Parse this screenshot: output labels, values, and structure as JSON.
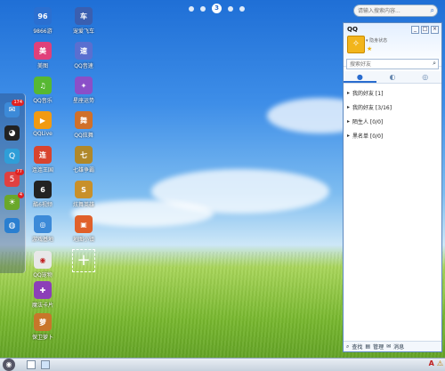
{
  "pager": {
    "current": "3"
  },
  "search": {
    "placeholder": "请输入搜索内容..."
  },
  "desktop_apps": [
    {
      "label": "9866游",
      "icon": "9866-game-icon",
      "color": "#2b6fd0",
      "glyph": "96"
    },
    {
      "label": "宠爱飞车",
      "icon": "racing-car-icon",
      "color": "#3a5fb0",
      "glyph": "车"
    },
    {
      "label": "美图",
      "icon": "meitu-icon",
      "color": "#e0407a",
      "glyph": "美"
    },
    {
      "label": "QQ音速",
      "icon": "qq-speed-icon",
      "color": "#5a6fd0",
      "glyph": "速"
    },
    {
      "label": "QQ音乐",
      "icon": "qq-music-icon",
      "color": "#57b832",
      "glyph": "♫"
    },
    {
      "label": "星座运势",
      "icon": "horoscope-icon",
      "color": "#8a4fc8",
      "glyph": "✦"
    },
    {
      "label": "QQLive",
      "icon": "qqlive-icon",
      "color": "#f29a12",
      "glyph": "▶"
    },
    {
      "label": "QQ炫舞",
      "icon": "qq-dance-icon",
      "color": "#d0702a",
      "glyph": "舞"
    },
    {
      "label": "连连王国",
      "icon": "lianlian-icon",
      "color": "#d8442f",
      "glyph": "连"
    },
    {
      "label": "七雄争霸",
      "icon": "qixiong-icon",
      "color": "#b0882a",
      "glyph": "七"
    },
    {
      "label": "酷6视频",
      "icon": "ku6-video-icon",
      "color": "#222222",
      "glyph": "6"
    },
    {
      "label": "炫舞英雄",
      "icon": "hero-icon",
      "color": "#c8902a",
      "glyph": "S"
    },
    {
      "label": "游戏基地",
      "icon": "game-base-icon",
      "color": "#3c8ad8",
      "glyph": "◎"
    },
    {
      "label": "地图小镇",
      "icon": "map-town-icon",
      "color": "#e0602a",
      "glyph": "▣"
    },
    {
      "label": "QQ宠物",
      "icon": "qq-pet-icon",
      "color": "#e8e8e8",
      "glyph": "◉"
    },
    {
      "label": "魔法卡片",
      "icon": "magic-card-icon",
      "color": "#8c3fb8",
      "glyph": "✚"
    },
    {
      "label": "保卫萝卜",
      "icon": "carrot-icon",
      "color": "#c8762a",
      "glyph": "萝"
    }
  ],
  "dock": [
    {
      "icon": "mail-icon",
      "color": "#3c8ad8",
      "glyph": "✉",
      "badge": "174"
    },
    {
      "icon": "qq-penguin-icon",
      "color": "#222222",
      "glyph": "◕",
      "badge": ""
    },
    {
      "icon": "qzone-icon",
      "color": "#2f9ed8",
      "glyph": "Q",
      "badge": ""
    },
    {
      "icon": "calendar-icon",
      "color": "#e04040",
      "glyph": "5",
      "badge": "77"
    },
    {
      "icon": "weather-icon",
      "color": "#6aa82a",
      "glyph": "☀",
      "badge": "4"
    },
    {
      "icon": "browser-globe-icon",
      "color": "#2a7fd0",
      "glyph": "◍",
      "badge": ""
    }
  ],
  "qq": {
    "title": "QQ",
    "window_min": "_",
    "window_max": "□",
    "window_close": "×",
    "status": "▾ 隐身状态",
    "star": "★",
    "search_placeholder": "搜索好友",
    "tabs": [
      "●",
      "◐",
      "◎"
    ],
    "groups": [
      {
        "label": "我的好友 [1]"
      },
      {
        "label": "我的好友 [3/16]"
      },
      {
        "label": "陌生人 [0/0]"
      },
      {
        "label": "黑名单 [0/0]"
      }
    ],
    "footer": [
      "查找",
      "管理",
      "消息"
    ]
  },
  "taskbar": {
    "tray": [
      "A",
      "⚠"
    ]
  }
}
